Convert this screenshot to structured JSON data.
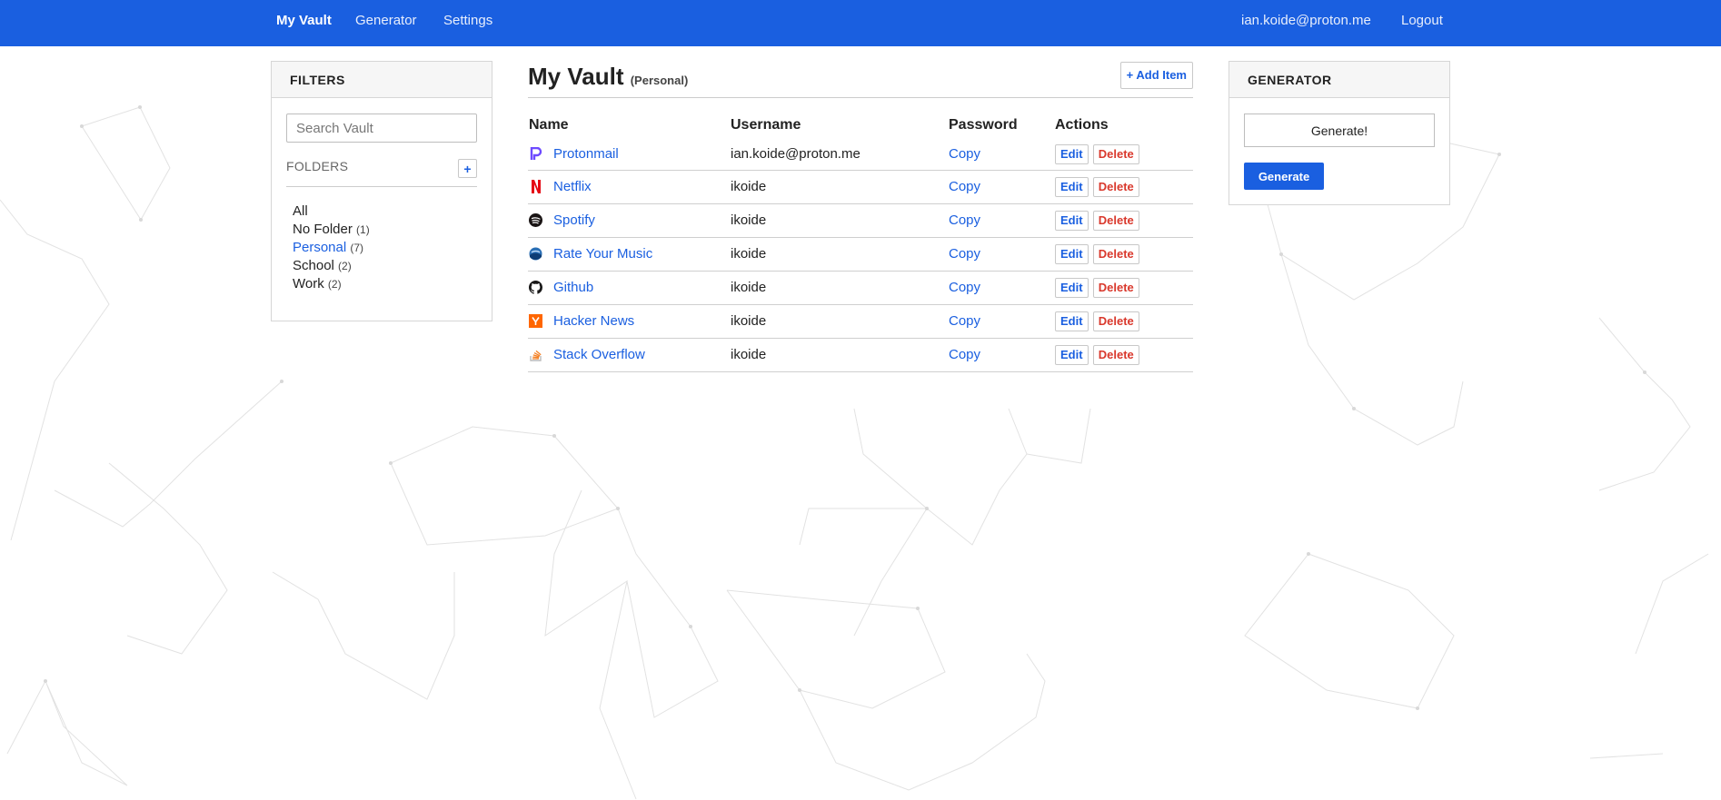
{
  "nav": {
    "left": [
      "My Vault",
      "Generator",
      "Settings"
    ],
    "email": "ian.koide@proton.me",
    "logout": "Logout"
  },
  "filters": {
    "title": "FILTERS",
    "search_placeholder": "Search Vault",
    "folders_label": "FOLDERS",
    "add_folder": "+",
    "folders": [
      {
        "name": "All",
        "count": ""
      },
      {
        "name": "No Folder",
        "count": "(1)"
      },
      {
        "name": "Personal",
        "count": "(7)"
      },
      {
        "name": "School",
        "count": "(2)"
      },
      {
        "name": "Work",
        "count": "(2)"
      }
    ]
  },
  "vault": {
    "title": "My Vault",
    "subtitle": "(Personal)",
    "add_item": "+ Add Item",
    "columns": [
      "Name",
      "Username",
      "Password",
      "Actions"
    ],
    "copy_label": "Copy",
    "edit_label": "Edit",
    "delete_label": "Delete",
    "items": [
      {
        "name": "Protonmail",
        "username": "ian.koide@proton.me",
        "icon": "protonmail-icon",
        "icon_color": "#6d4aff"
      },
      {
        "name": "Netflix",
        "username": "ikoide",
        "icon": "netflix-icon",
        "icon_color": "#e50914"
      },
      {
        "name": "Spotify",
        "username": "ikoide",
        "icon": "spotify-icon",
        "icon_color": "#191414"
      },
      {
        "name": "Rate Your Music",
        "username": "ikoide",
        "icon": "rateyourmusic-icon",
        "icon_color": "#2a6fb5"
      },
      {
        "name": "Github",
        "username": "ikoide",
        "icon": "github-icon",
        "icon_color": "#181717"
      },
      {
        "name": "Hacker News",
        "username": "ikoide",
        "icon": "hackernews-icon",
        "icon_color": "#ff6600"
      },
      {
        "name": "Stack Overflow",
        "username": "ikoide",
        "icon": "stackoverflow-icon",
        "icon_color": "#f48024"
      }
    ]
  },
  "generator": {
    "title": "GENERATOR",
    "value": "Generate!",
    "button": "Generate"
  },
  "colors": {
    "brand": "#1a5fe0",
    "danger": "#d9382c"
  }
}
